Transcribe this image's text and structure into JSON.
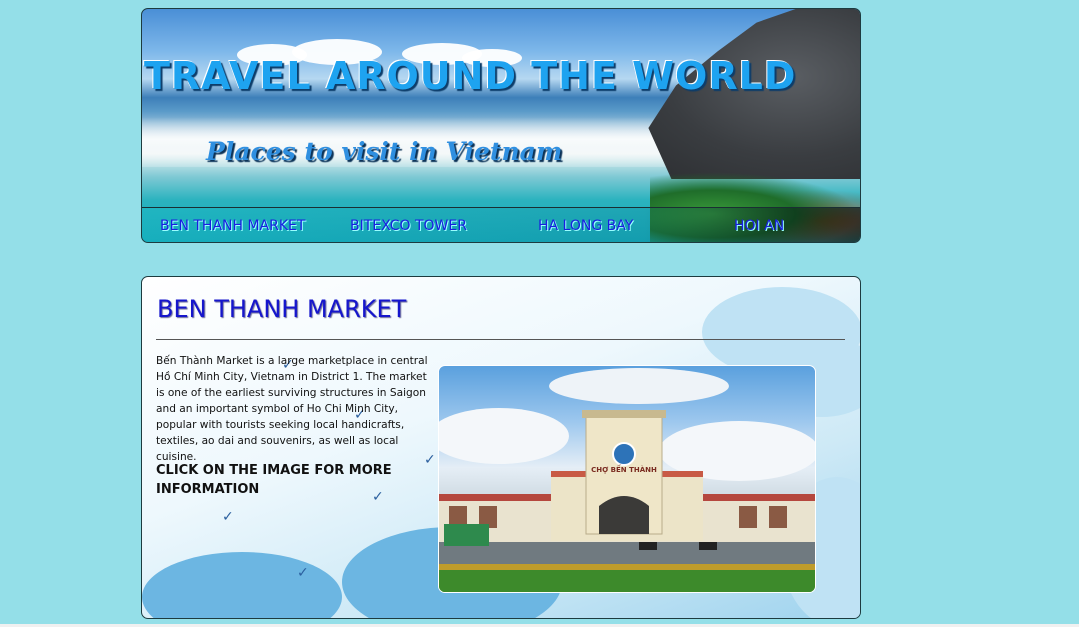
{
  "header": {
    "title": "TRAVEL AROUND THE WORLD",
    "subtitle": "Places to visit in Vietnam",
    "nav": [
      {
        "label": "BEN THANH MARKET"
      },
      {
        "label": "BITEXCO TOWER"
      },
      {
        "label": "HA LONG BAY"
      },
      {
        "label": "HOI AN"
      }
    ]
  },
  "main": {
    "heading": "BEN THANH MARKET",
    "description": "Bến Thành Market is a large marketplace in central Hồ Chí Minh City, Vietnam in District 1. The market is one of the earliest surviving structures in Saigon and an important symbol of Ho Chi Minh City, popular with tourists seeking local handicrafts, textiles, ao dai and souvenirs, as well as local cuisine.",
    "cta": "CLICK ON THE IMAGE FOR MORE INFORMATION",
    "photo_sign": "CHỢ BẾN THÀNH"
  },
  "colors": {
    "page_background": "#94dfe8",
    "nav_text": "#1a1fe0",
    "heading_text": "#1616cc",
    "title_text": "#1ea3f0"
  }
}
